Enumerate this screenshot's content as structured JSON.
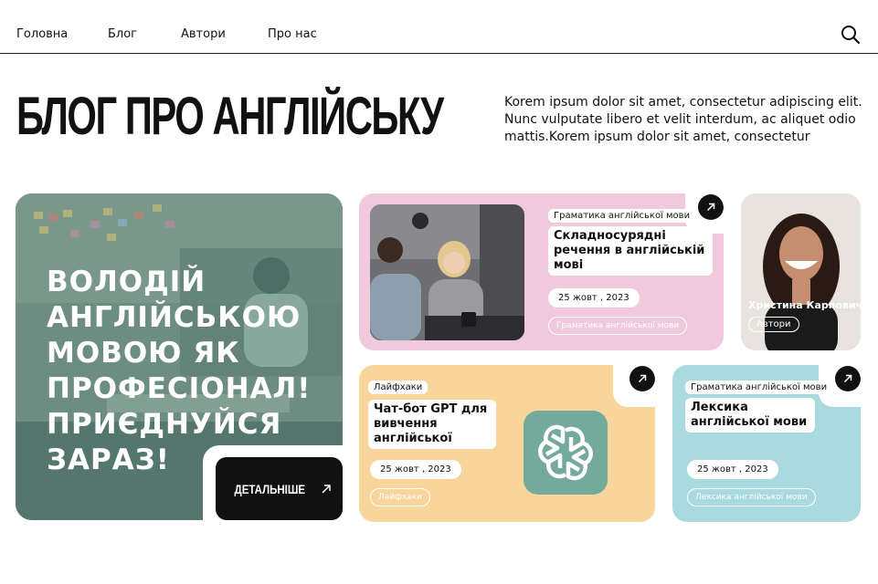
{
  "nav": {
    "items": [
      "Головна",
      "Блог",
      "Автори",
      "Про нас"
    ],
    "search_icon": "search-icon"
  },
  "hero": {
    "title": "БЛОГ ПРО АНГЛІЙСЬКУ",
    "description": "Korem ipsum dolor sit amet, consectetur adipiscing elit. Nunc vulputate libero et velit interdum, ac aliquet odio mattis.Korem ipsum dolor sit amet, consectetur"
  },
  "promo": {
    "text": "ВОЛОДІЙ АНГЛІЙСЬКОЮ МОВОЮ ЯК ПРОФЕСІОНАЛ! ПРИЄДНУЙСЯ ЗАРАЗ!",
    "button_label": "ДЕТАЛЬНІШЕ"
  },
  "cards": [
    {
      "category": "Граматика англійської мови",
      "title": "Складносурядні речення в англійській мові",
      "date": "25 жовт , 2023",
      "tag": "Граматика англійської мови",
      "color": "#f0c9dc"
    },
    {
      "category": "Лайфхаки",
      "title": "Чат-бот GPT для вивчення англійської",
      "date": "25 жовт , 2023",
      "tag": "Лайфхаки",
      "color": "#f8d59b"
    },
    {
      "category": "Граматика англійської мови",
      "title": "Лексика англійської мови",
      "date": "25 жовт , 2023",
      "tag": "Лексика англійської мови",
      "color": "#a8dae0"
    }
  ],
  "author": {
    "name": "Христина Карпович",
    "role": "Автори"
  }
}
